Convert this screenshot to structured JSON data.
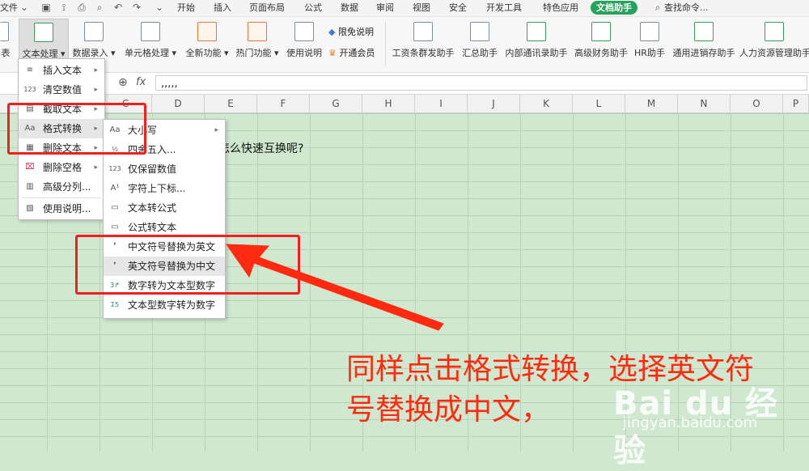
{
  "menubar": {
    "file": "文件",
    "tabs": [
      "开始",
      "插入",
      "页面布局",
      "公式",
      "数据",
      "审阅",
      "视图",
      "安全",
      "开发工具",
      "特色应用",
      "文档助手"
    ],
    "search": "查找命令..."
  },
  "ribbon": {
    "cut_label": "表",
    "items": [
      "文本处理",
      "数据录入",
      "单元格处理",
      "全新功能",
      "热门功能",
      "使用说明"
    ],
    "side": [
      "限免说明",
      "开通会员"
    ],
    "assistants": [
      "工资条群发助手",
      "汇总助手",
      "内部通讯录助手",
      "高级财务助手",
      "HR助手",
      "通用进销存助手",
      "人力资源管理助手"
    ]
  },
  "formula": {
    "fx": "fx",
    "value": ",,,,,"
  },
  "columns": [
    "C",
    "D",
    "E",
    "F",
    "G",
    "H",
    "I",
    "J",
    "K",
    "L",
    "M",
    "N",
    "O",
    "P"
  ],
  "cell_text": "怎么快速互换呢?",
  "main_menu": {
    "items": [
      "插入文本",
      "清空数值",
      "截取文本",
      "格式转换",
      "删除文本",
      "删除空格",
      "高级分列...",
      "使用说明..."
    ]
  },
  "sub_menu": {
    "items": [
      "大小写",
      "四舍五入...",
      "仅保留数值",
      "字符上下标...",
      "文本转公式",
      "公式转文本",
      "中文符号替换为英文",
      "英文符号替换为中文",
      "数字转为文本型数字",
      "文本型数字转为数字"
    ]
  },
  "annotation": {
    "line1": "同样点击格式转换，选择英文符",
    "line2": "号替换成中文，"
  },
  "watermark": {
    "brand": "Bai du 经验",
    "url": "jingyan.baidu.com"
  },
  "colors": {
    "accent": "#26a35a",
    "annotation": "#ff2a10"
  }
}
